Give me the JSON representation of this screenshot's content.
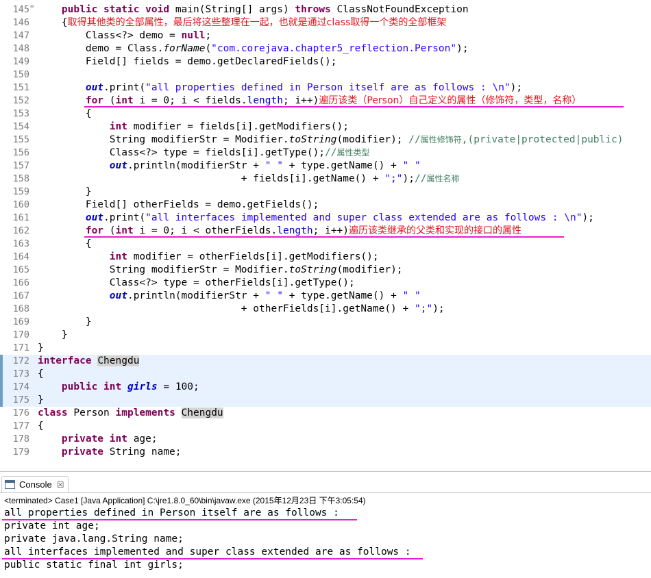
{
  "editor": {
    "lines": [
      {
        "num": "145",
        "fold": "⊖",
        "tokens": [
          [
            "",
            "    "
          ],
          [
            "kw",
            "public"
          ],
          [
            "",
            " "
          ],
          [
            "kw",
            "static"
          ],
          [
            "",
            " "
          ],
          [
            "kw",
            "void"
          ],
          [
            "",
            " main(String[] args) "
          ],
          [
            "kw",
            "throws"
          ],
          [
            "",
            " ClassNotFoundException"
          ]
        ]
      },
      {
        "num": "146",
        "tokens": [
          [
            "",
            "    {"
          ],
          [
            "anno",
            "取得其他类的全部属性，最后将这些整理在一起，也就是通过class取得一个类的全部框架"
          ]
        ]
      },
      {
        "num": "147",
        "tokens": [
          [
            "",
            "        Class<?> demo = "
          ],
          [
            "kw",
            "null"
          ],
          [
            "",
            ";"
          ]
        ]
      },
      {
        "num": "148",
        "tokens": [
          [
            "",
            "        demo = Class."
          ],
          [
            "it",
            "forName"
          ],
          [
            "",
            "("
          ],
          [
            "str",
            "\"com.corejava.chapter5_reflection.Person\""
          ],
          [
            "",
            ");"
          ]
        ]
      },
      {
        "num": "149",
        "tokens": [
          [
            "",
            "        Field[] fields = demo.getDeclaredFields();"
          ]
        ]
      },
      {
        "num": "150",
        "tokens": []
      },
      {
        "num": "151",
        "tokens": [
          [
            "",
            "        "
          ],
          [
            "sfld",
            "out"
          ],
          [
            "",
            ".print("
          ],
          [
            "str",
            "\"all properties defined in Person itself are as follows : \\n\""
          ],
          [
            "",
            ");"
          ]
        ]
      },
      {
        "num": "152",
        "tokens": [
          [
            "",
            "        "
          ],
          [
            "kw",
            "for"
          ],
          [
            "",
            " ("
          ],
          [
            "kw",
            "int"
          ],
          [
            "",
            " i = 0; i < fields."
          ],
          [
            "fld",
            "length"
          ],
          [
            "",
            "; i++)"
          ],
          [
            "anno",
            "遍历该类（Person）自己定义的属性（修饰符，类型，名称）"
          ]
        ]
      },
      {
        "num": "153",
        "tokens": [
          [
            "",
            "        {"
          ]
        ]
      },
      {
        "num": "154",
        "tokens": [
          [
            "",
            "            "
          ],
          [
            "kw",
            "int"
          ],
          [
            "",
            " modifier = fields[i].getModifiers();"
          ]
        ]
      },
      {
        "num": "155",
        "tokens": [
          [
            "",
            "            String modifierStr = Modifier."
          ],
          [
            "it",
            "toString"
          ],
          [
            "",
            "(modifier); "
          ],
          [
            "cmt",
            "//"
          ],
          [
            "cmt-zh",
            "属性修饰符"
          ],
          [
            "cmt",
            ",(private|protected|public)"
          ]
        ]
      },
      {
        "num": "156",
        "tokens": [
          [
            "",
            "            Class<?> type = fields[i].getType();"
          ],
          [
            "cmt",
            "//"
          ],
          [
            "cmt-zh",
            "属性类型"
          ]
        ]
      },
      {
        "num": "157",
        "tokens": [
          [
            "",
            "            "
          ],
          [
            "sfld",
            "out"
          ],
          [
            "",
            ".println(modifierStr + "
          ],
          [
            "str",
            "\" \""
          ],
          [
            "",
            " + type.getName() + "
          ],
          [
            "str",
            "\" \""
          ]
        ]
      },
      {
        "num": "158",
        "tokens": [
          [
            "",
            "                                  + fields[i].getName() + "
          ],
          [
            "str",
            "\";\""
          ],
          [
            "",
            ");"
          ],
          [
            "cmt",
            "//"
          ],
          [
            "cmt-zh",
            "属性名称"
          ]
        ]
      },
      {
        "num": "159",
        "tokens": [
          [
            "",
            "        }"
          ]
        ]
      },
      {
        "num": "160",
        "tokens": [
          [
            "",
            "        Field[] otherFields = demo.getFields();"
          ]
        ]
      },
      {
        "num": "161",
        "tokens": [
          [
            "",
            "        "
          ],
          [
            "sfld",
            "out"
          ],
          [
            "",
            ".print("
          ],
          [
            "str",
            "\"all interfaces implemented and super class extended are as follows : \\n\""
          ],
          [
            "",
            ");"
          ]
        ]
      },
      {
        "num": "162",
        "tokens": [
          [
            "",
            "        "
          ],
          [
            "kw",
            "for"
          ],
          [
            "",
            " ("
          ],
          [
            "kw",
            "int"
          ],
          [
            "",
            " i = 0; i < otherFields."
          ],
          [
            "fld",
            "length"
          ],
          [
            "",
            "; i++)"
          ],
          [
            "anno",
            "遍历该类继承的父类和实现的接口的属性"
          ]
        ]
      },
      {
        "num": "163",
        "tokens": [
          [
            "",
            "        {"
          ]
        ]
      },
      {
        "num": "164",
        "tokens": [
          [
            "",
            "            "
          ],
          [
            "kw",
            "int"
          ],
          [
            "",
            " modifier = otherFields[i].getModifiers();"
          ]
        ]
      },
      {
        "num": "165",
        "tokens": [
          [
            "",
            "            String modifierStr = Modifier."
          ],
          [
            "it",
            "toString"
          ],
          [
            "",
            "(modifier);"
          ]
        ]
      },
      {
        "num": "166",
        "tokens": [
          [
            "",
            "            Class<?> type = otherFields[i].getType();"
          ]
        ]
      },
      {
        "num": "167",
        "tokens": [
          [
            "",
            "            "
          ],
          [
            "sfld",
            "out"
          ],
          [
            "",
            ".println(modifierStr + "
          ],
          [
            "str",
            "\" \""
          ],
          [
            "",
            " + type.getName() + "
          ],
          [
            "str",
            "\" \""
          ]
        ]
      },
      {
        "num": "168",
        "tokens": [
          [
            "",
            "                                  + otherFields[i].getName() + "
          ],
          [
            "str",
            "\";\""
          ],
          [
            "",
            ");"
          ]
        ]
      },
      {
        "num": "169",
        "tokens": [
          [
            "",
            "        }"
          ]
        ]
      },
      {
        "num": "170",
        "tokens": [
          [
            "",
            "    }"
          ]
        ]
      },
      {
        "num": "171",
        "tokens": [
          [
            "",
            "}"
          ]
        ]
      },
      {
        "num": "172",
        "mark": true,
        "tokens": [
          [
            "kw",
            "interface"
          ],
          [
            "",
            " "
          ],
          [
            "occ",
            "Chengdu"
          ]
        ]
      },
      {
        "num": "173",
        "mark": true,
        "tokens": [
          [
            "",
            "{"
          ]
        ]
      },
      {
        "num": "174",
        "mark": true,
        "tokens": [
          [
            "",
            "    "
          ],
          [
            "kw",
            "public"
          ],
          [
            "",
            " "
          ],
          [
            "kw",
            "int"
          ],
          [
            "",
            " "
          ],
          [
            "sfld",
            "girls"
          ],
          [
            "",
            " = 100;"
          ]
        ]
      },
      {
        "num": "175",
        "mark": true,
        "tokens": [
          [
            "",
            "}"
          ]
        ]
      },
      {
        "num": "176",
        "tokens": [
          [
            "kw",
            "class"
          ],
          [
            "",
            " Person "
          ],
          [
            "kw",
            "implements"
          ],
          [
            "",
            " "
          ],
          [
            "occ",
            "Chengdu"
          ]
        ]
      },
      {
        "num": "177",
        "tokens": [
          [
            "",
            "{"
          ]
        ]
      },
      {
        "num": "178",
        "tokens": [
          [
            "",
            "    "
          ],
          [
            "kw",
            "private"
          ],
          [
            "",
            " "
          ],
          [
            "kw",
            "int"
          ],
          [
            "",
            " age;"
          ]
        ]
      },
      {
        "num": "179",
        "tokens": [
          [
            "",
            "    "
          ],
          [
            "kw",
            "private"
          ],
          [
            "",
            " String name;"
          ]
        ]
      }
    ]
  },
  "console": {
    "tab_label": "Console",
    "close_glyph": "☒",
    "status": "<terminated> Case1 [Java Application] C:\\jre1.8.0_60\\bin\\javaw.exe (2015年12月23日 下午3:05:54)",
    "output": [
      "all properties defined in Person itself are as follows :",
      "private int age;",
      "private java.lang.String name;",
      "all interfaces implemented and super class extended are as follows :",
      "public static final int girls;"
    ]
  },
  "colors": {
    "underline": "#e51fd4",
    "annotation": "#e0141e",
    "keyword": "#7f0055",
    "string": "#2a00ff"
  }
}
